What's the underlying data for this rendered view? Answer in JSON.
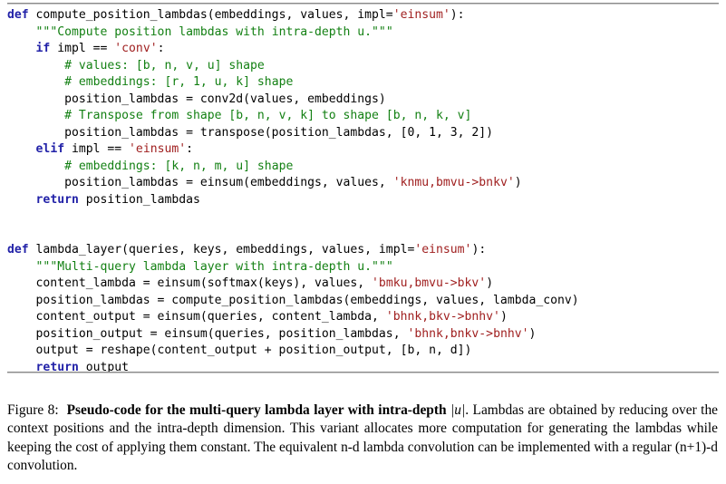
{
  "figure": {
    "rules": {
      "top_label": "listing-top-rule",
      "bottom_label": "listing-bottom-rule"
    },
    "code": {
      "language": "python",
      "lines": [
        [
          {
            "t": "kw",
            "s": "def"
          },
          {
            "t": "pln",
            "s": " compute_position_lambdas(embeddings, values, impl="
          },
          {
            "t": "str",
            "s": "'einsum'"
          },
          {
            "t": "pln",
            "s": "):"
          }
        ],
        [
          {
            "t": "pln",
            "s": "    "
          },
          {
            "t": "doc",
            "s": "\"\"\"Compute position lambdas with intra-depth u.\"\"\""
          }
        ],
        [
          {
            "t": "pln",
            "s": "    "
          },
          {
            "t": "kw",
            "s": "if"
          },
          {
            "t": "pln",
            "s": " impl == "
          },
          {
            "t": "str",
            "s": "'conv'"
          },
          {
            "t": "pln",
            "s": ":"
          }
        ],
        [
          {
            "t": "pln",
            "s": "        "
          },
          {
            "t": "com",
            "s": "# values: [b, n, v, u] shape"
          }
        ],
        [
          {
            "t": "pln",
            "s": "        "
          },
          {
            "t": "com",
            "s": "# embeddings: [r, 1, u, k] shape"
          }
        ],
        [
          {
            "t": "pln",
            "s": "        position_lambdas = conv2d(values, embeddings)"
          }
        ],
        [
          {
            "t": "pln",
            "s": "        "
          },
          {
            "t": "com",
            "s": "# Transpose from shape [b, n, v, k] to shape [b, n, k, v]"
          }
        ],
        [
          {
            "t": "pln",
            "s": "        position_lambdas = transpose(position_lambdas, [0, 1, 3, 2])"
          }
        ],
        [
          {
            "t": "pln",
            "s": "    "
          },
          {
            "t": "kw",
            "s": "elif"
          },
          {
            "t": "pln",
            "s": " impl == "
          },
          {
            "t": "str",
            "s": "'einsum'"
          },
          {
            "t": "pln",
            "s": ":"
          }
        ],
        [
          {
            "t": "pln",
            "s": "        "
          },
          {
            "t": "com",
            "s": "# embeddings: [k, n, m, u] shape"
          }
        ],
        [
          {
            "t": "pln",
            "s": "        position_lambdas = einsum(embeddings, values, "
          },
          {
            "t": "str",
            "s": "'knmu,bmvu->bnkv'"
          },
          {
            "t": "pln",
            "s": ")"
          }
        ],
        [
          {
            "t": "pln",
            "s": "    "
          },
          {
            "t": "kw",
            "s": "return"
          },
          {
            "t": "pln",
            "s": " position_lambdas"
          }
        ],
        [],
        [],
        [
          {
            "t": "kw",
            "s": "def"
          },
          {
            "t": "pln",
            "s": " lambda_layer(queries, keys, embeddings, values, impl="
          },
          {
            "t": "str",
            "s": "'einsum'"
          },
          {
            "t": "pln",
            "s": "):"
          }
        ],
        [
          {
            "t": "pln",
            "s": "    "
          },
          {
            "t": "doc",
            "s": "\"\"\"Multi-query lambda layer with intra-depth u.\"\"\""
          }
        ],
        [
          {
            "t": "pln",
            "s": "    content_lambda = einsum(softmax(keys), values, "
          },
          {
            "t": "str",
            "s": "'bmku,bmvu->bkv'"
          },
          {
            "t": "pln",
            "s": ")"
          }
        ],
        [
          {
            "t": "pln",
            "s": "    position_lambdas = compute_position_lambdas(embeddings, values, lambda_conv)"
          }
        ],
        [
          {
            "t": "pln",
            "s": "    content_output = einsum(queries, content_lambda, "
          },
          {
            "t": "str",
            "s": "'bhnk,bkv->bnhv'"
          },
          {
            "t": "pln",
            "s": ")"
          }
        ],
        [
          {
            "t": "pln",
            "s": "    position_output = einsum(queries, position_lambdas, "
          },
          {
            "t": "str",
            "s": "'bhnk,bnkv->bnhv'"
          },
          {
            "t": "pln",
            "s": ")"
          }
        ],
        [
          {
            "t": "pln",
            "s": "    output = reshape(content_output + position_output, [b, n, d])"
          }
        ],
        [
          {
            "t": "pln",
            "s": "    "
          },
          {
            "t": "kw",
            "s": "return"
          },
          {
            "t": "pln",
            "s": " output"
          }
        ]
      ],
      "colors": {
        "keyword": "#2222a8",
        "string": "#a02020",
        "comment": "#138013",
        "docstring": "#138013",
        "plain": "#000000"
      }
    },
    "caption": {
      "label": "Figure 8:",
      "title_bold": "Pseudo-code for the multi-query lambda layer with intra-depth",
      "math_symbol": "|u|",
      "body": ". Lambdas are obtained by reducing over the context positions and the intra-depth dimension. This variant allocates more computation for generating the lambdas while keeping the cost of applying them constant. The equivalent n-d lambda convolution can be implemented with a regular (n+1)-d convolution."
    }
  }
}
